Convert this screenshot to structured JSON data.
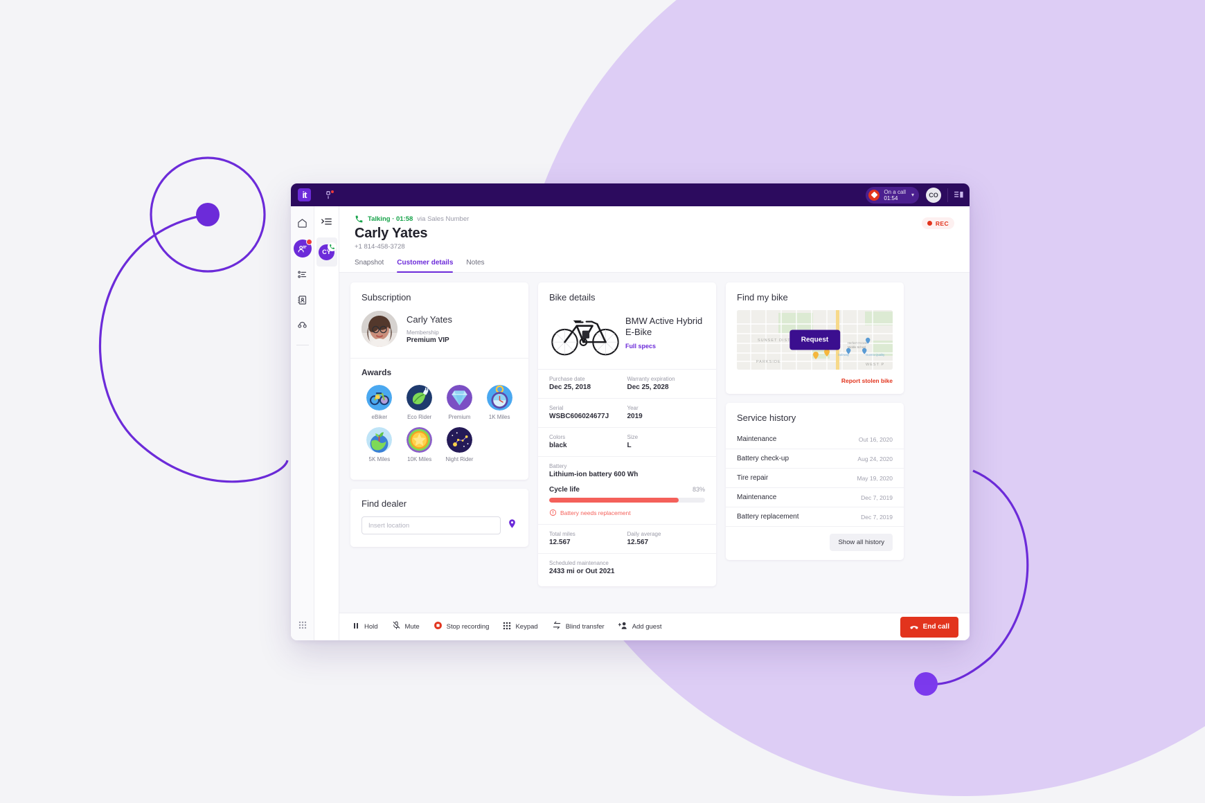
{
  "titlebar": {
    "logo": "it",
    "call_status_label": "On a call",
    "call_timer": "01:54",
    "user_initials": "CO"
  },
  "rail": {
    "items": [
      {
        "name": "home",
        "icon": "home-icon"
      },
      {
        "name": "contacts",
        "icon": "user-conversation-icon",
        "active": true,
        "badge": true
      },
      {
        "name": "tasks",
        "icon": "list-icon"
      },
      {
        "name": "address-book",
        "icon": "contact-card-icon"
      },
      {
        "name": "calls",
        "icon": "handset-icon"
      }
    ]
  },
  "rail2": {
    "collapse_icon": "collapse-panel-icon",
    "conversation_initials": "CY"
  },
  "header": {
    "status": "Talking · 01:58",
    "via": "via Sales Number",
    "customer_name": "Carly Yates",
    "customer_phone": "+1 814-458-3728",
    "recording_badge": "REC"
  },
  "tabs": [
    {
      "label": "Snapshot",
      "active": false
    },
    {
      "label": "Customer details",
      "active": true
    },
    {
      "label": "Notes",
      "active": false
    }
  ],
  "subscription": {
    "title": "Subscription",
    "name": "Carly Yates",
    "membership_label": "Membership",
    "membership_value": "Premium VIP"
  },
  "awards": {
    "title": "Awards",
    "items": [
      {
        "label": "eBiker",
        "badge": "ebike-badge"
      },
      {
        "label": "Eco Rider",
        "badge": "eco-leaf-badge"
      },
      {
        "label": "Premium",
        "badge": "diamond-badge"
      },
      {
        "label": "1K Miles",
        "badge": "pocket-watch-badge"
      },
      {
        "label": "5K Miles",
        "badge": "earth-sprout-badge"
      },
      {
        "label": "10K Miles",
        "badge": "gold-star-badge"
      },
      {
        "label": "Night Rider",
        "badge": "constellation-badge"
      }
    ]
  },
  "find_dealer": {
    "title": "Find dealer",
    "placeholder": "Insert location",
    "value": ""
  },
  "bike": {
    "title": "Bike details",
    "model": "BMW Active Hybrid E-Bike",
    "full_specs_link": "Full specs",
    "specs": [
      [
        {
          "label": "Purchase date",
          "value": "Dec 25, 2018"
        },
        {
          "label": "Warranty expiration",
          "value": "Dec 25, 2028"
        }
      ],
      [
        {
          "label": "Serial",
          "value": "WSBC606024677J"
        },
        {
          "label": "Year",
          "value": "2019"
        }
      ],
      [
        {
          "label": "Colors",
          "value": "black"
        },
        {
          "label": "Size",
          "value": "L"
        }
      ]
    ],
    "battery_label": "Battery",
    "battery_value": "Lithium-ion battery 600 Wh",
    "cycle_life_label": "Cycle life",
    "cycle_life_pct": "83%",
    "cycle_life_value": 83,
    "battery_warning": "Battery needs replacement",
    "totals": [
      {
        "label": "Total miles",
        "value": "12.567"
      },
      {
        "label": "Daily average",
        "value": "12.567"
      }
    ],
    "scheduled_label": "Scheduled maintenance",
    "scheduled_value": "2433 mi or Out 2021"
  },
  "find_bike": {
    "title": "Find my bike",
    "request_button": "Request",
    "report_link": "Report stolen bike",
    "map_labels": [
      "SUNSET DISTRICT",
      "PARKSIDE",
      "WEST P",
      "Herbert Hoover Middle School",
      "Safeway",
      "Guerra Quality"
    ]
  },
  "service_history": {
    "title": "Service history",
    "rows": [
      {
        "name": "Maintenance",
        "date": "Out 16, 2020"
      },
      {
        "name": "Battery check-up",
        "date": "Aug 24, 2020"
      },
      {
        "name": "Tire repair",
        "date": "May 19, 2020"
      },
      {
        "name": "Maintenance",
        "date": "Dec 7, 2019"
      },
      {
        "name": "Battery replacement",
        "date": "Dec 7, 2019"
      }
    ],
    "show_all_button": "Show all history"
  },
  "footer": {
    "actions": [
      {
        "label": "Hold",
        "icon": "pause-icon"
      },
      {
        "label": "Mute",
        "icon": "mic-off-icon"
      },
      {
        "label": "Stop recording",
        "icon": "record-stop-icon"
      },
      {
        "label": "Keypad",
        "icon": "keypad-icon"
      },
      {
        "label": "Blind transfer",
        "icon": "transfer-arrow-icon"
      },
      {
        "label": "Add guest",
        "icon": "add-person-icon"
      }
    ],
    "end_call": "End call"
  },
  "colors": {
    "brand_purple": "#6c2bd9",
    "dark_purple": "#2c0b5e",
    "danger_red": "#e2341d",
    "warning_red": "#f4605a",
    "success_green": "#17a34a"
  }
}
